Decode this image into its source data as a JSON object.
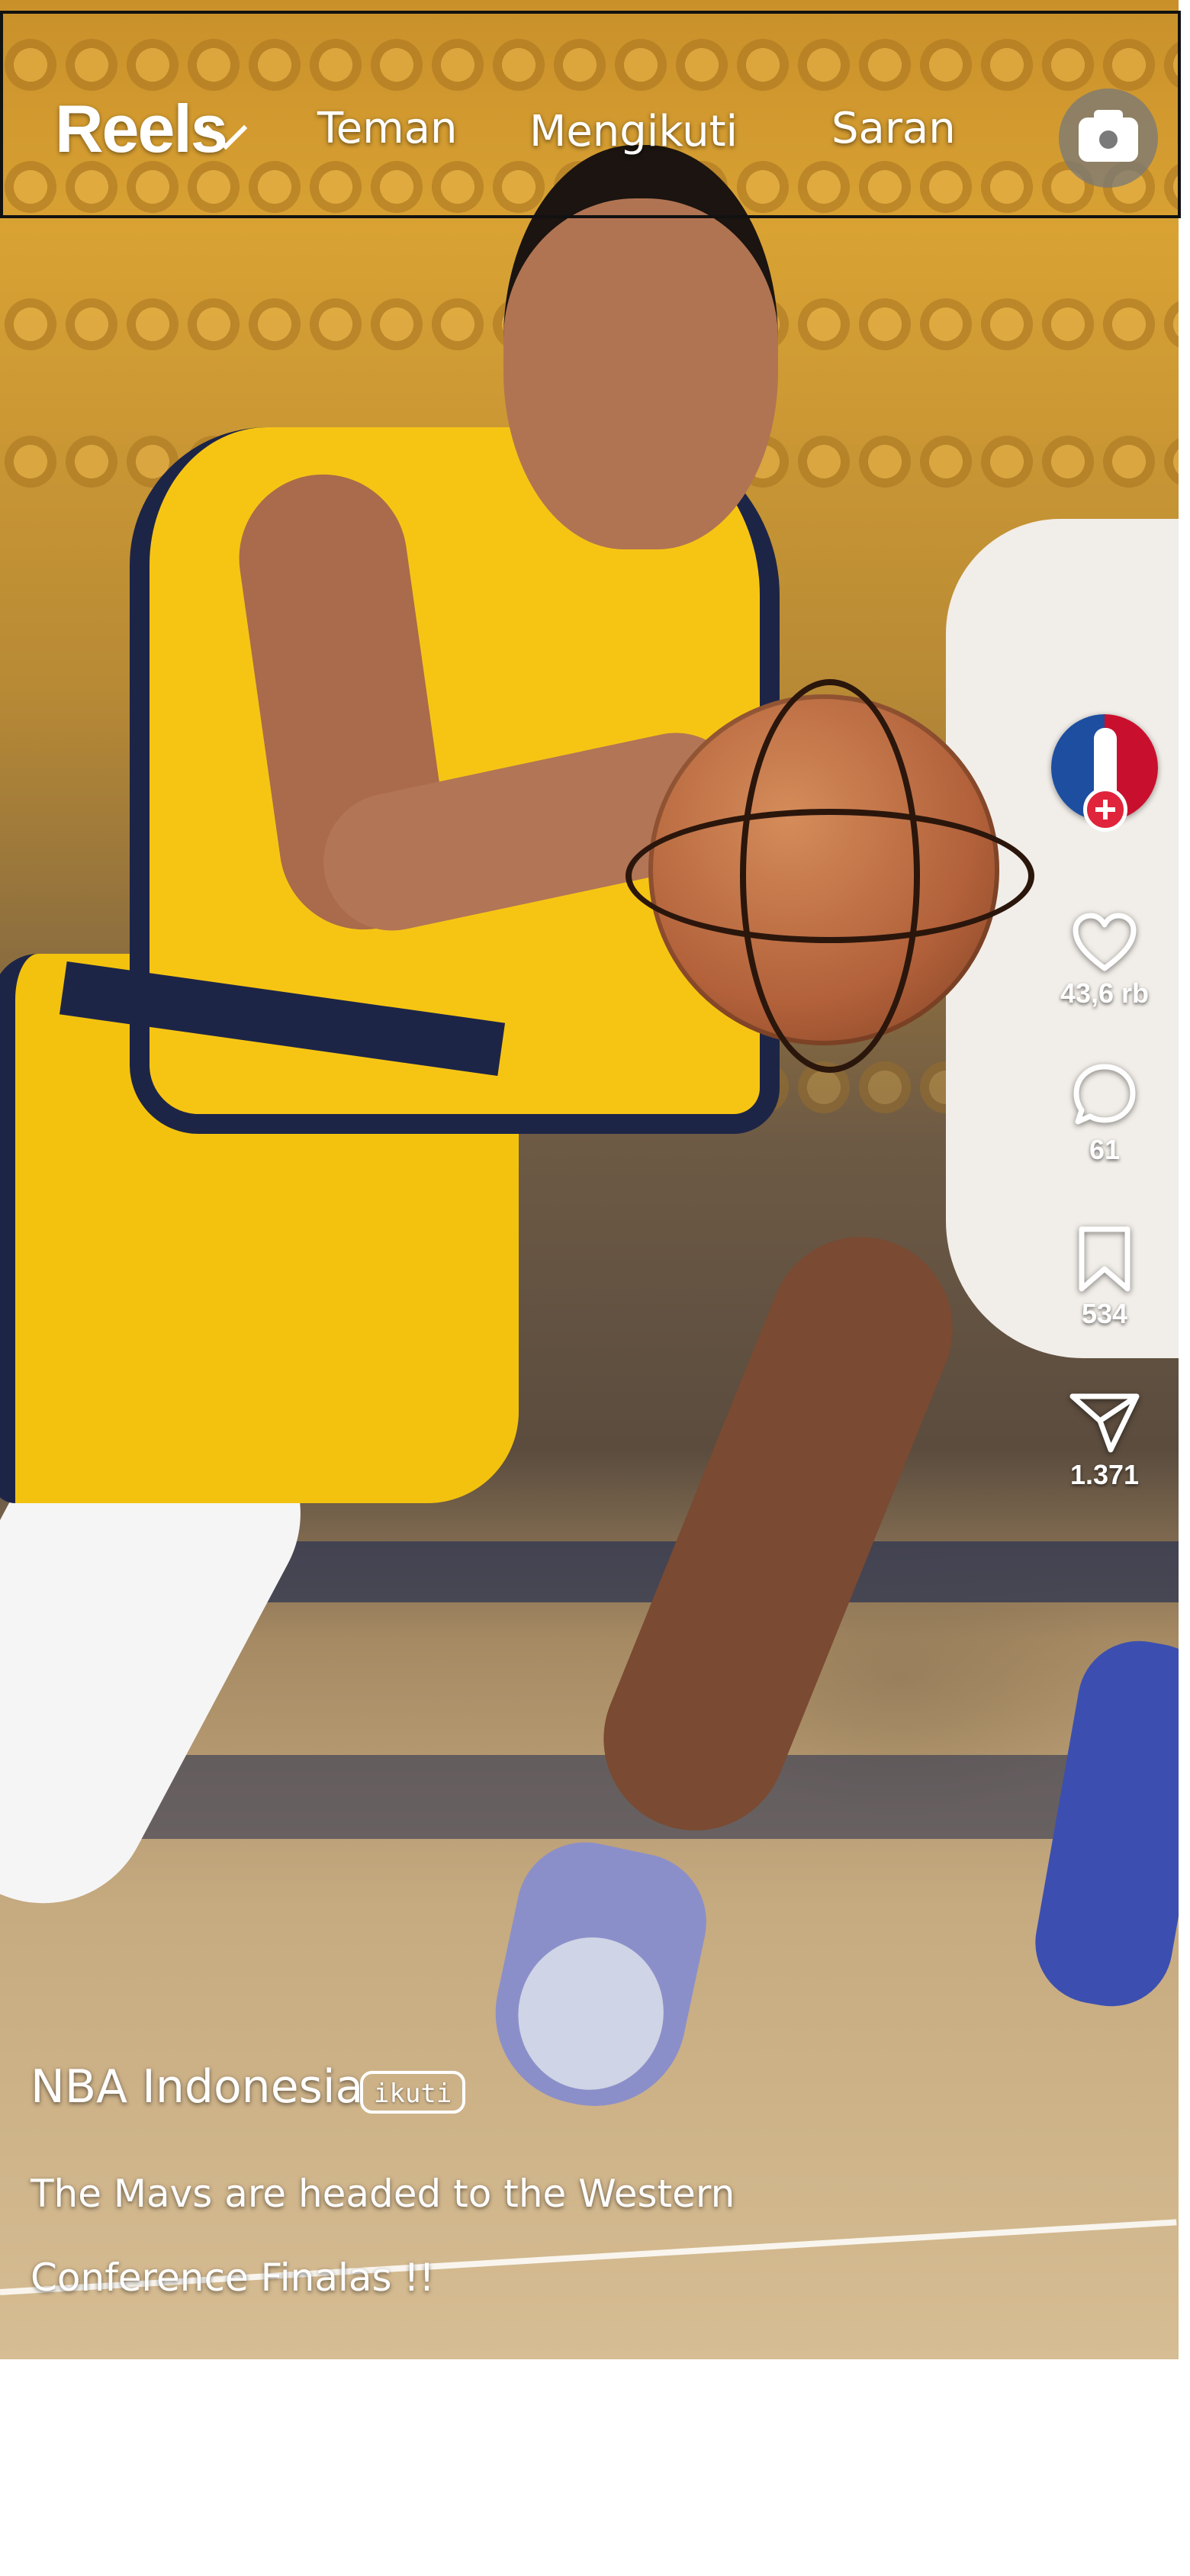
{
  "header": {
    "brand": "Reels",
    "tabs": [
      {
        "label": "Teman"
      },
      {
        "label": "Mengikuti"
      },
      {
        "label": "Saran"
      }
    ],
    "camera_icon": "camera-icon"
  },
  "actions": {
    "likes": "43,6 rb",
    "comments": "61",
    "saves": "534",
    "shares": "1.371"
  },
  "post": {
    "account_name": "NBA Indonesia",
    "follow_label": "ikuti",
    "caption": "The Mavs are headed to the Western Conference Finalas !!"
  },
  "colors": {
    "jersey_yellow": "#f6c514",
    "jersey_navy": "#1d2547",
    "follow_badge": "#e0243b"
  }
}
